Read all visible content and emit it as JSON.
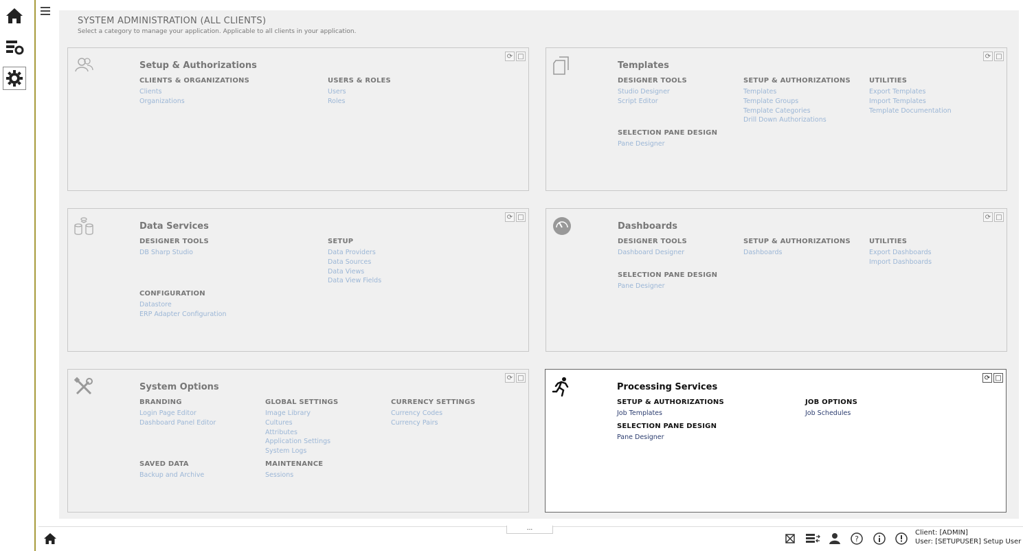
{
  "header": {
    "title": "SYSTEM ADMINISTRATION (ALL CLIENTS)",
    "subtitle": "Select a category to manage your application. Applicable to all clients in your application."
  },
  "cards": {
    "setup": {
      "title": "Setup & Authorizations",
      "icon": "users-icon",
      "sections": [
        {
          "heading": "CLIENTS & ORGANIZATIONS",
          "links": [
            "Clients",
            "Organizations"
          ]
        },
        {
          "heading": "USERS & ROLES",
          "links": [
            "Users",
            "Roles"
          ]
        }
      ]
    },
    "templates": {
      "title": "Templates",
      "icon": "documents-icon",
      "sections": [
        {
          "heading": "DESIGNER TOOLS",
          "links": [
            "Studio Designer",
            "Script Editor"
          ]
        },
        {
          "heading": "SETUP & AUTHORIZATIONS",
          "links": [
            "Templates",
            "Template Groups",
            "Template Categories",
            "Drill Down Authorizations"
          ]
        },
        {
          "heading": "UTILITIES",
          "links": [
            "Export Templates",
            "Import Templates",
            "Template Documentation"
          ]
        },
        {
          "heading": "SELECTION PANE DESIGN",
          "links": [
            "Pane Designer"
          ]
        }
      ]
    },
    "data": {
      "title": "Data Services",
      "icon": "database-icon",
      "sections": [
        {
          "heading": "DESIGNER TOOLS",
          "links": [
            "DB Sharp Studio"
          ]
        },
        {
          "heading": "SETUP",
          "links": [
            "Data Providers",
            "Data Sources",
            "Data Views",
            "Data View Fields"
          ]
        },
        {
          "heading": "CONFIGURATION",
          "links": [
            "Datastore",
            "ERP Adapter Configuration"
          ]
        }
      ]
    },
    "dashboards": {
      "title": "Dashboards",
      "icon": "gauge-icon",
      "sections": [
        {
          "heading": "DESIGNER TOOLS",
          "links": [
            "Dashboard Designer"
          ]
        },
        {
          "heading": "SETUP & AUTHORIZATIONS",
          "links": [
            "Dashboards"
          ]
        },
        {
          "heading": "UTILITIES",
          "links": [
            "Export Dashboards",
            "Import Dashboards"
          ]
        },
        {
          "heading": "SELECTION PANE DESIGN",
          "links": [
            "Pane Designer"
          ]
        }
      ]
    },
    "system": {
      "title": "System Options",
      "icon": "tools-icon",
      "sections": [
        {
          "heading": "BRANDING",
          "links": [
            "Login Page Editor",
            "Dashboard Panel Editor"
          ]
        },
        {
          "heading": "GLOBAL SETTINGS",
          "links": [
            "Image Library",
            "Cultures",
            "Attributes",
            "Application Settings",
            "System Logs"
          ]
        },
        {
          "heading": "CURRENCY SETTINGS",
          "links": [
            "Currency Codes",
            "Currency Pairs"
          ]
        },
        {
          "heading": "SAVED DATA",
          "links": [
            "Backup and Archive"
          ]
        },
        {
          "heading": "MAINTENANCE",
          "links": [
            "Sessions"
          ]
        }
      ]
    },
    "processing": {
      "title": "Processing Services",
      "icon": "runner-icon",
      "sections": [
        {
          "heading": "SETUP & AUTHORIZATIONS",
          "links": [
            "Job Templates"
          ]
        },
        {
          "heading": "JOB OPTIONS",
          "links": [
            "Job Schedules"
          ]
        },
        {
          "heading": "SELECTION PANE DESIGN",
          "links": [
            "Pane Designer"
          ]
        }
      ]
    }
  },
  "footer": {
    "dots": "...",
    "client": "Client: [ADMIN]",
    "user": "User: [SETUPUSER] Setup User"
  }
}
